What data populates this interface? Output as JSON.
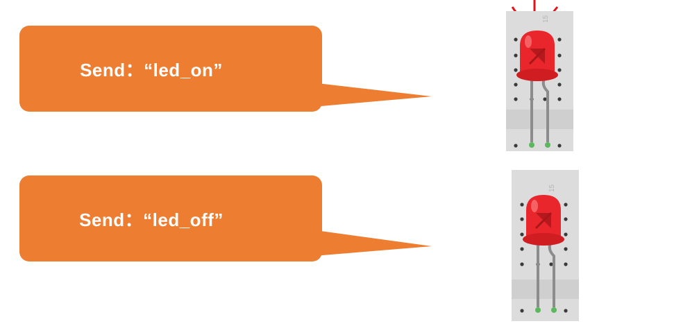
{
  "colors": {
    "callout": "#ed7d31",
    "board": "#dcdcdc",
    "board_stripe": "#cfcfcf",
    "led": "#e8262b",
    "led_shade": "#a8161a",
    "lead": "#8c8c8c",
    "lead_tip": "#5cb85c",
    "ray": "#e3131b"
  },
  "callouts": [
    {
      "label": "Send：“led_on”"
    },
    {
      "label": "Send：“led_off”"
    }
  ],
  "breadboards": [
    {
      "column_label": "15",
      "led_state": "on"
    },
    {
      "column_label": "15",
      "led_state": "off"
    }
  ]
}
